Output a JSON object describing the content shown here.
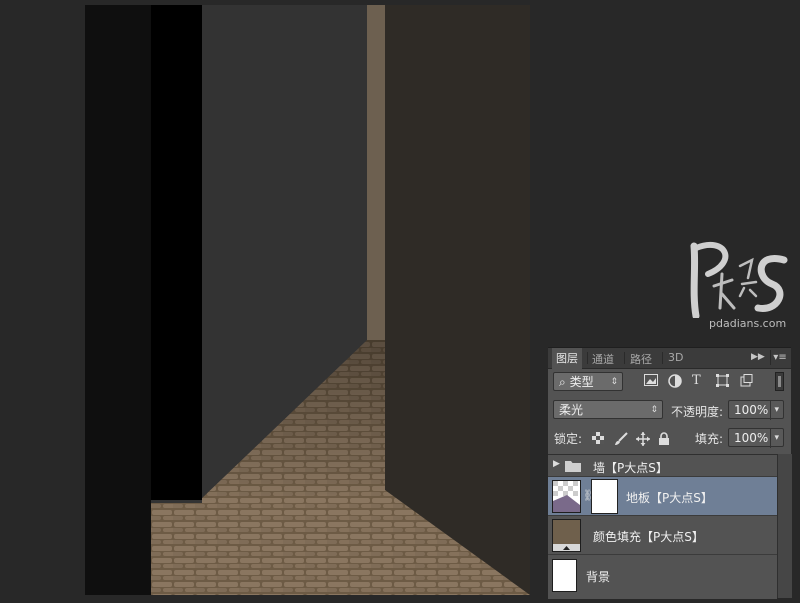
{
  "layers_panel": {
    "tabs": [
      "图层",
      "通道",
      "路径",
      "3D"
    ],
    "active_tab": "图层",
    "filter_kind": "类型",
    "blend_mode": "柔光",
    "opacity_label": "不透明度:",
    "opacity_value": "100%",
    "lock_label": "锁定:",
    "fill_label": "填充:",
    "fill_value": "100%",
    "layers": [
      {
        "name": "墙【P大点S】",
        "kind": "group",
        "selected": false
      },
      {
        "name": "地板【P大点S】",
        "kind": "masked-pixel",
        "selected": true
      },
      {
        "name": "颜色填充【P大点S】",
        "kind": "color-fill",
        "selected": false,
        "fill_color": "#6f604c"
      },
      {
        "name": "背景",
        "kind": "background",
        "selected": false
      }
    ],
    "selection_color": "#6f7f96"
  },
  "watermark": {
    "logo_text": "PS大点",
    "url": "pdadians.com"
  },
  "canvas": {
    "colors": {
      "left_shadow": "#0f0f0f",
      "black_wall": "#000000",
      "left_wall": "#333333",
      "far_strip": "#6d6050",
      "right_wall": "#2f2b26",
      "floor": "#6e5c46"
    }
  }
}
